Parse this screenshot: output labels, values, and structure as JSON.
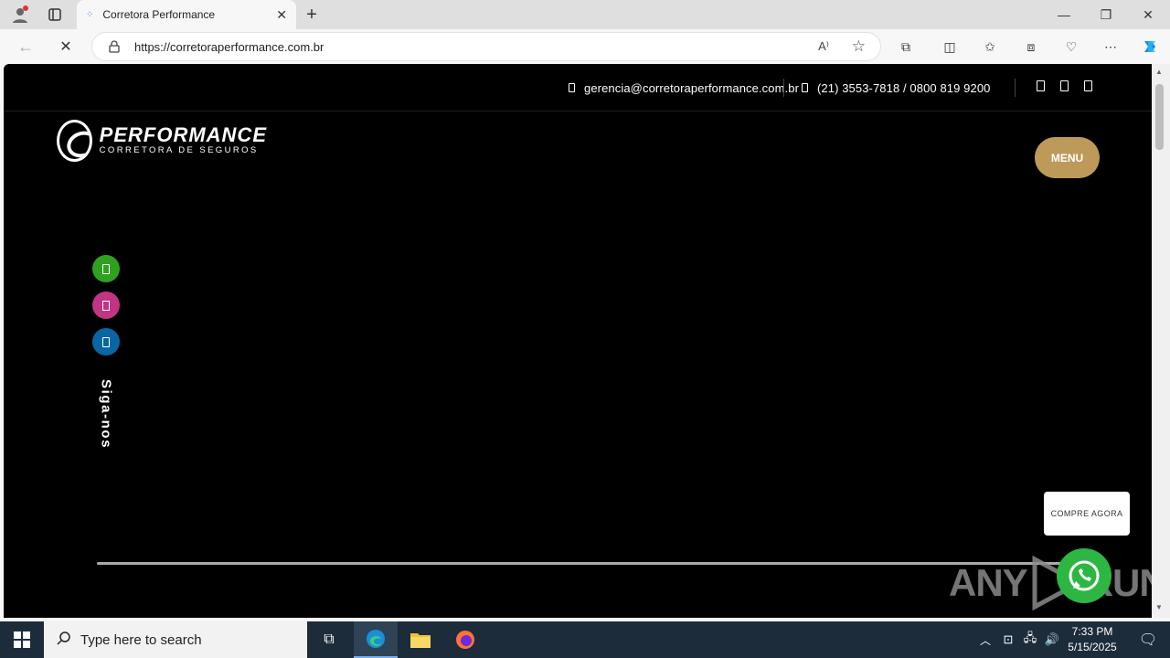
{
  "browser": {
    "tab_title": "Corretora Performance",
    "url": "https://corretoraperformance.com.br"
  },
  "site": {
    "email": "gerencia@corretoraperformance.com.br",
    "phone": "(21) 3553-7818 / 0800 819 9200",
    "logo_title": "PERFORMANCE",
    "logo_subtitle": "CORRETORA DE SEGUROS",
    "menu_label": "MENU",
    "follow_label": "Siga-nos",
    "cta_label": "COMPRE AGORA",
    "social_colors": {
      "whatsapp": "#2fa01f",
      "instagram": "#c13584",
      "linkedin": "#0a66a2"
    },
    "accent": "#bd9a5a"
  },
  "watermark": "ANY RUN",
  "taskbar": {
    "search_placeholder": "Type here to search",
    "time": "7:33 PM",
    "date": "5/15/2025"
  }
}
